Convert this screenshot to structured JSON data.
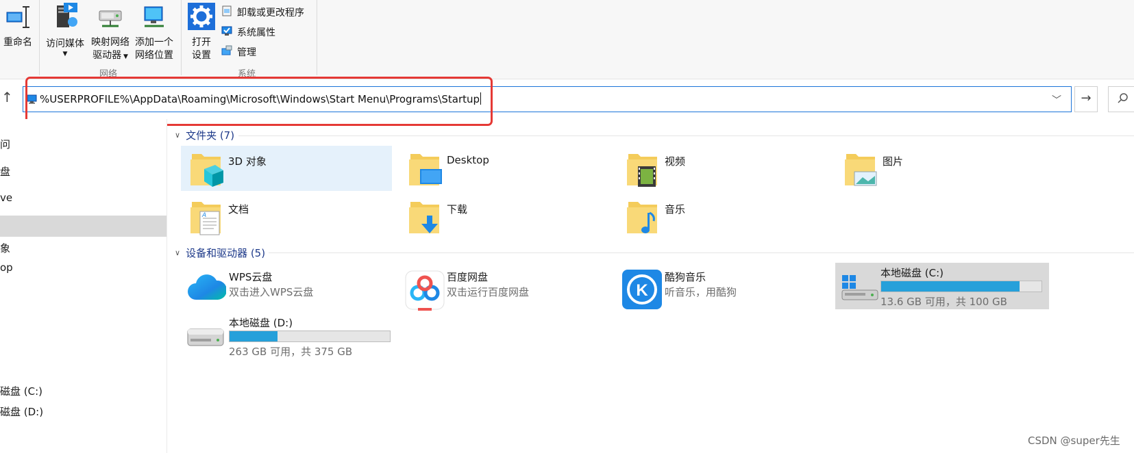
{
  "ribbon": {
    "rename_label": "重命名",
    "access_media_label": "访问媒体",
    "map_drive_label_1": "映射网络",
    "map_drive_label_2": "驱动器",
    "add_location_label_1": "添加一个",
    "add_location_label_2": "网络位置",
    "network_group": "网络",
    "open_settings_label_1": "打开",
    "open_settings_label_2": "设置",
    "uninstall_label": "卸载或更改程序",
    "system_properties_label": "系统属性",
    "manage_label": "管理",
    "system_group": "系统"
  },
  "address": {
    "path": "%USERPROFILE%\\AppData\\Roaming\\Microsoft\\Windows\\Start Menu\\Programs\\Startup"
  },
  "nav": {
    "items": [
      "问",
      "盘",
      "ve",
      "象",
      "op",
      "磁盘 (C:)",
      "磁盘 (D:)"
    ]
  },
  "folders": {
    "header": "文件夹 (7)",
    "items": [
      {
        "name": "3D 对象"
      },
      {
        "name": "Desktop"
      },
      {
        "name": "视频"
      },
      {
        "name": "图片"
      },
      {
        "name": "文档"
      },
      {
        "name": "下载"
      },
      {
        "name": "音乐"
      }
    ]
  },
  "devices": {
    "header": "设备和驱动器 (5)",
    "items": [
      {
        "name": "WPS云盘",
        "sub": "双击进入WPS云盘"
      },
      {
        "name": "百度网盘",
        "sub": "双击运行百度网盘"
      },
      {
        "name": "酷狗音乐",
        "sub": "听音乐，用酷狗"
      },
      {
        "name": "本地磁盘 (C:)",
        "sub": "13.6 GB 可用，共 100 GB",
        "used_fraction": 0.864
      },
      {
        "name": "本地磁盘 (D:)",
        "sub": "263 GB 可用，共 375 GB",
        "used_fraction": 0.299
      }
    ]
  },
  "watermark": "CSDN @super先生",
  "colors": {
    "accent": "#1a73d9",
    "highlight": "#e53935",
    "drive_fill": "#26a0da",
    "section_header": "#1e3a8a"
  }
}
